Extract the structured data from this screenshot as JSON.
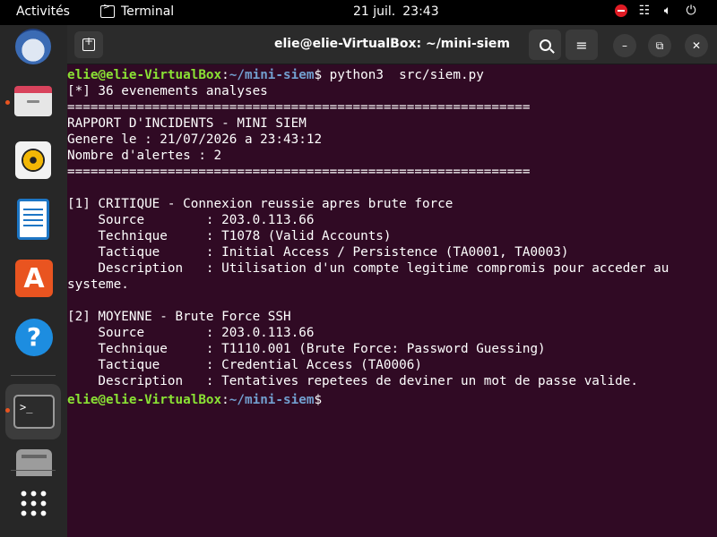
{
  "topbar": {
    "activities": "Activités",
    "app_name": "Terminal",
    "date": "21 juil.",
    "time": "23:43",
    "tray": [
      "do-not-disturb-icon",
      "network-icon",
      "volume-icon",
      "power-icon"
    ]
  },
  "dock": {
    "items": [
      {
        "name": "thunderbird",
        "running": false
      },
      {
        "name": "files",
        "running": true
      },
      {
        "name": "rhythmbox",
        "running": false
      },
      {
        "name": "libreoffice-writer",
        "running": false
      },
      {
        "name": "ubuntu-software",
        "running": false
      },
      {
        "name": "help",
        "running": false
      },
      {
        "name": "terminal",
        "running": true,
        "active": true
      },
      {
        "name": "drive",
        "running": false
      },
      {
        "name": "show-apps",
        "running": false
      }
    ]
  },
  "window": {
    "title": "elie@elie-VirtualBox: ~/mini-siem"
  },
  "prompt": {
    "user": "elie@elie-VirtualBox",
    "colon": ":",
    "path": "~/mini-siem",
    "symbol": "$"
  },
  "terminal": {
    "command": " python3  src/siem.py",
    "lines": [
      "[*] 36 evenements analyses",
      "============================================================",
      "RAPPORT D'INCIDENTS - MINI SIEM",
      "Genere le : 21/07/2026 a 23:43:12",
      "Nombre d'alertes : 2",
      "============================================================",
      "",
      "[1] CRITIQUE - Connexion reussie apres brute force",
      "    Source        : 203.0.113.66",
      "    Technique     : T1078 (Valid Accounts)",
      "    Tactique      : Initial Access / Persistence (TA0001, TA0003)",
      "    Description   : Utilisation d'un compte legitime compromis pour acceder au",
      "systeme.",
      "",
      "[2] MOYENNE - Brute Force SSH",
      "    Source        : 203.0.113.66",
      "    Technique     : T1110.001 (Brute Force: Password Guessing)",
      "    Tactique      : Credential Access (TA0006)",
      "    Description   : Tentatives repetees de deviner un mot de passe valide."
    ]
  },
  "colors": {
    "terminal_bg": "#300a24",
    "prompt_user": "#8ae234",
    "prompt_path": "#729fcf",
    "accent": "#e95420"
  }
}
